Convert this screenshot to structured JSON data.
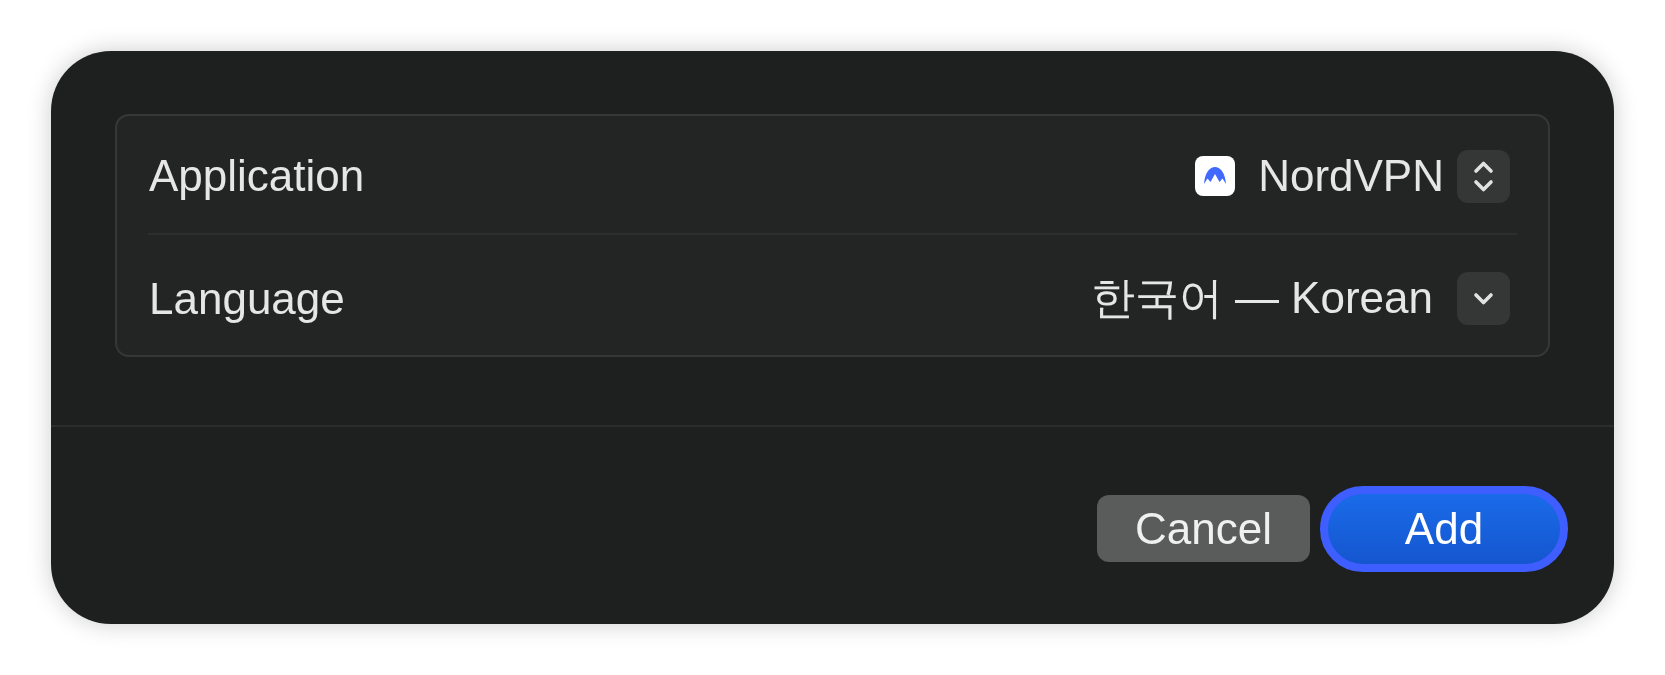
{
  "dialog": {
    "rows": [
      {
        "label": "Application",
        "kind": "app-picker",
        "value": "NordVPN"
      },
      {
        "label": "Language",
        "kind": "dropdown",
        "value": "한국어 — Korean"
      }
    ]
  },
  "buttons": [
    {
      "label": "Cancel",
      "kind": "secondary",
      "focused": false
    },
    {
      "label": "Add",
      "kind": "primary",
      "focused": true
    }
  ]
}
